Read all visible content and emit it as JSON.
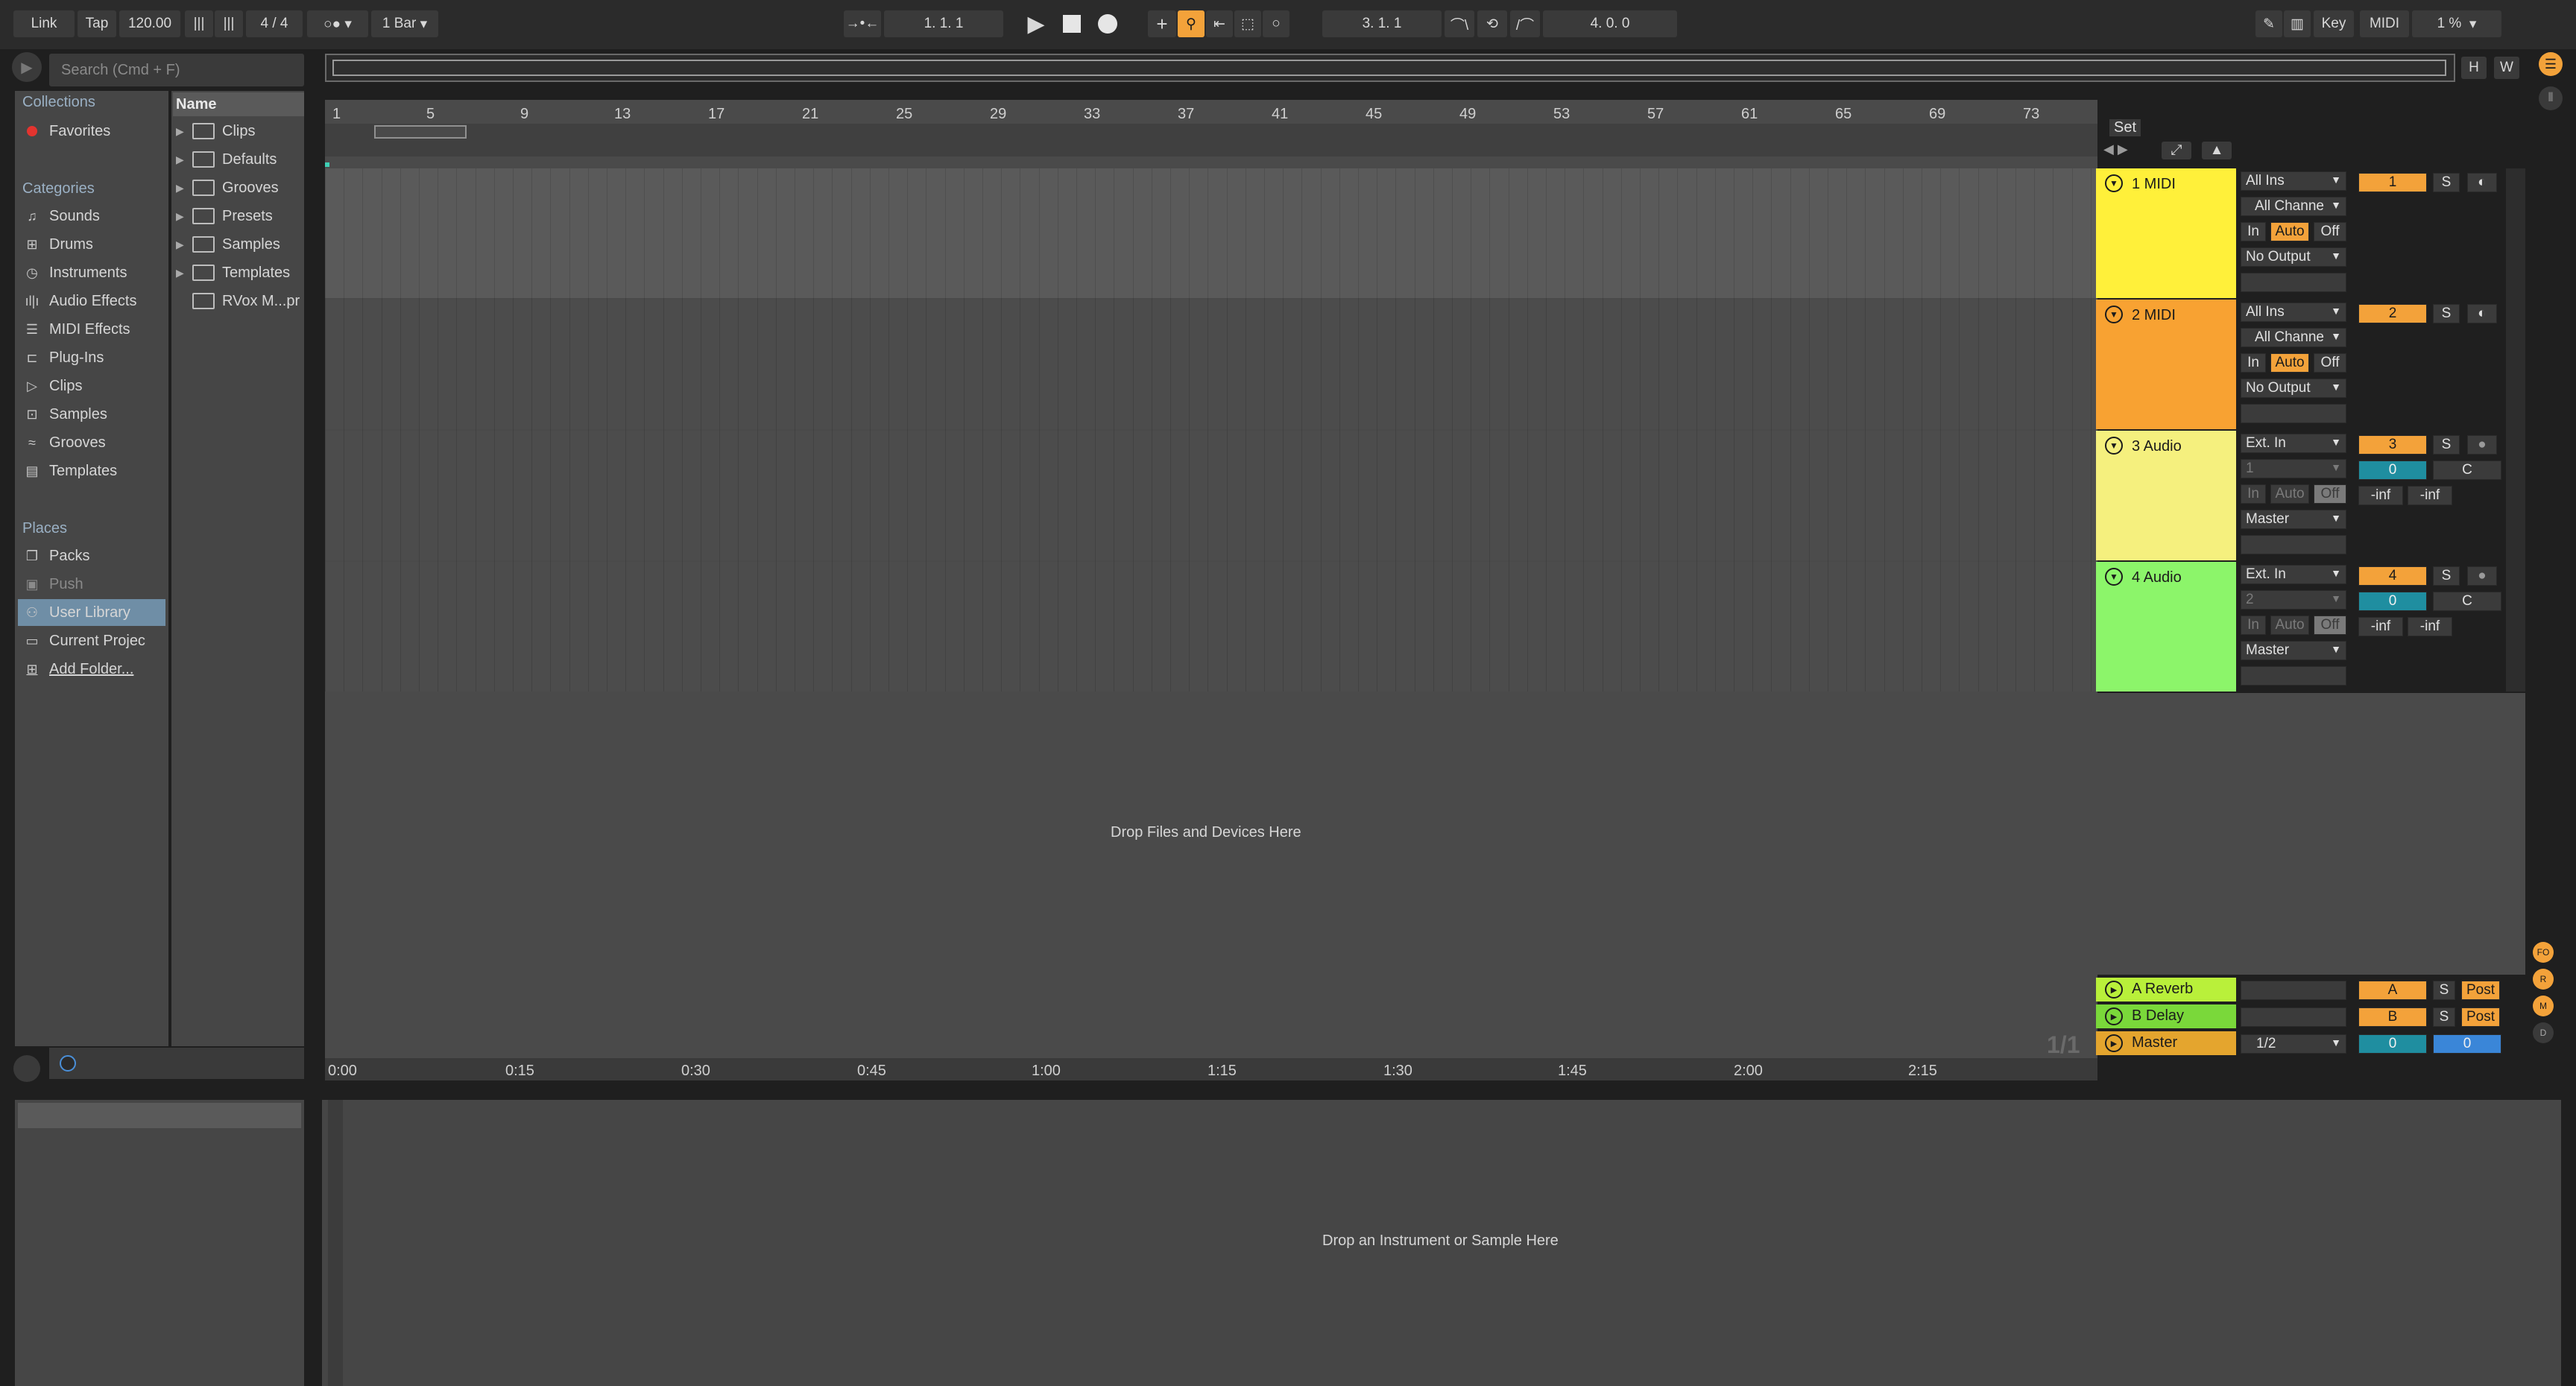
{
  "transport": {
    "link": "Link",
    "tap": "Tap",
    "tempo": "120.00",
    "signature": "4 / 4",
    "quantize": "1 Bar",
    "position": "1.   1.   1",
    "loop_start": "3.   1.   1",
    "loop_length": "4.   0.   0",
    "key": "Key",
    "midi": "MIDI",
    "cpu": "1 %",
    "h": "H",
    "w": "W"
  },
  "browser": {
    "search_placeholder": "Search (Cmd + F)",
    "collections_heading": "Collections",
    "favorites": "Favorites",
    "categories_heading": "Categories",
    "categories": [
      "Sounds",
      "Drums",
      "Instruments",
      "Audio Effects",
      "MIDI Effects",
      "Plug-Ins",
      "Clips",
      "Samples",
      "Grooves",
      "Templates"
    ],
    "places_heading": "Places",
    "places": [
      "Packs",
      "Push",
      "User Library",
      "Current Projec",
      "Add Folder..."
    ],
    "name_header": "Name",
    "folders": [
      "Clips",
      "Defaults",
      "Grooves",
      "Presets",
      "Samples",
      "Templates",
      "RVox M...pr"
    ]
  },
  "arrangement": {
    "bar_numbers": [
      "1",
      "5",
      "9",
      "13",
      "17",
      "21",
      "25",
      "29",
      "33",
      "37",
      "41",
      "45",
      "49",
      "53",
      "57",
      "61",
      "65",
      "69",
      "73"
    ],
    "time_labels": [
      "0:00",
      "0:15",
      "0:30",
      "0:45",
      "1:00",
      "1:15",
      "1:30",
      "1:45",
      "2:00",
      "2:15"
    ],
    "set_label": "Set",
    "drop_files": "Drop Files and Devices Here",
    "page_indicator": "1/1"
  },
  "tracks": [
    {
      "name": "1 MIDI",
      "color": "#fff03a",
      "input": "All Ins",
      "channel": "All Channe",
      "monitor": [
        "In",
        "Auto",
        "Off"
      ],
      "output": "No Output",
      "number": "1",
      "solo": "S"
    },
    {
      "name": "2 MIDI",
      "color": "#f8a232",
      "input": "All Ins",
      "channel": "All Channe",
      "monitor": [
        "In",
        "Auto",
        "Off"
      ],
      "output": "No Output",
      "number": "2",
      "solo": "S"
    },
    {
      "name": "3 Audio",
      "color": "#f5f07e",
      "input": "Ext. In",
      "channel": "1",
      "monitor": [
        "In",
        "Auto",
        "Off"
      ],
      "output": "Master",
      "number": "3",
      "solo": "S",
      "send": "0",
      "pan": "C",
      "meter_l": "-inf",
      "meter_r": "-inf"
    },
    {
      "name": "4 Audio",
      "color": "#8cf56a",
      "input": "Ext. In",
      "channel": "2",
      "monitor": [
        "In",
        "Auto",
        "Off"
      ],
      "output": "Master",
      "number": "4",
      "solo": "S",
      "send": "0",
      "pan": "C",
      "meter_l": "-inf",
      "meter_r": "-inf"
    }
  ],
  "returns": [
    {
      "name": "A Reverb",
      "color": "#b9f03a",
      "letter": "A",
      "solo": "S",
      "post": "Post"
    },
    {
      "name": "B Delay",
      "color": "#7ad83a",
      "letter": "B",
      "solo": "S",
      "post": "Post"
    }
  ],
  "master": {
    "name": "Master",
    "color": "#e4a52e",
    "quant": "1/2",
    "value1": "0",
    "value2": "0"
  },
  "device": {
    "drop_instrument": "Drop an Instrument or Sample Here"
  },
  "right_icons": [
    "FO",
    "R",
    "M",
    "D"
  ]
}
